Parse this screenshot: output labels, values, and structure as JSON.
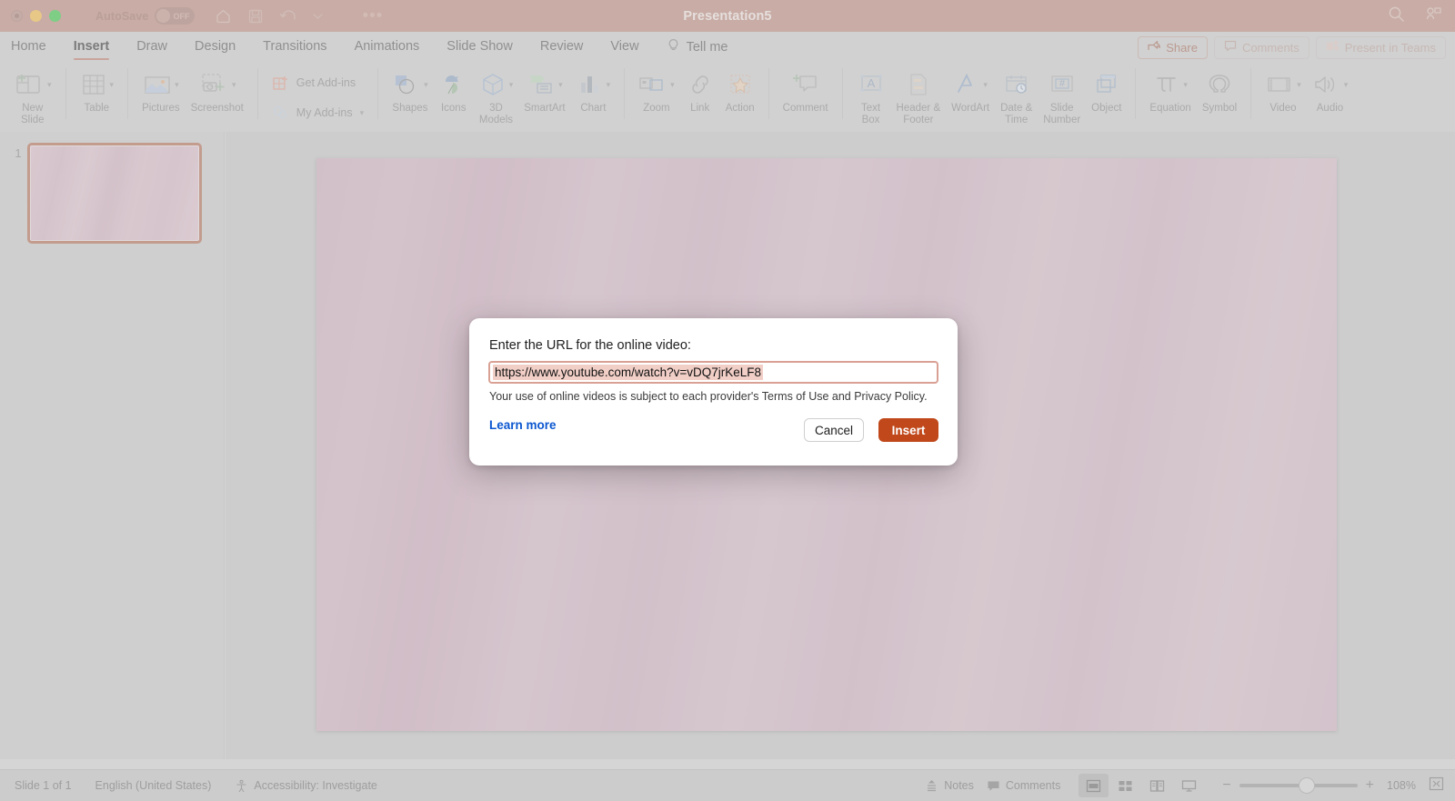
{
  "titlebar": {
    "autosave_label": "AutoSave",
    "autosave_state": "OFF",
    "document_title": "Presentation5",
    "icons": [
      "home-icon",
      "save-icon",
      "undo-icon",
      "chevron-down-icon",
      "more-icon"
    ],
    "right_icons": [
      "search-icon",
      "account-icon"
    ]
  },
  "menubar": {
    "tabs": [
      {
        "label": "Home",
        "active": false
      },
      {
        "label": "Insert",
        "active": true
      },
      {
        "label": "Draw",
        "active": false
      },
      {
        "label": "Design",
        "active": false
      },
      {
        "label": "Transitions",
        "active": false
      },
      {
        "label": "Animations",
        "active": false
      },
      {
        "label": "Slide Show",
        "active": false
      },
      {
        "label": "Review",
        "active": false
      },
      {
        "label": "View",
        "active": false
      }
    ],
    "tellme": "Tell me",
    "share": "Share",
    "comments": "Comments",
    "present_in_teams": "Present in Teams"
  },
  "ribbon": {
    "groups": [
      {
        "items": [
          {
            "label": "New\nSlide",
            "icon": "new-slide-icon",
            "chevron": true
          }
        ]
      },
      {
        "items": [
          {
            "label": "Table",
            "icon": "table-icon",
            "chevron": true
          }
        ]
      },
      {
        "items": [
          {
            "label": "Pictures",
            "icon": "pictures-icon",
            "chevron": true
          },
          {
            "label": "Screenshot",
            "icon": "screenshot-icon",
            "chevron": true
          }
        ]
      },
      {
        "stacked": [
          {
            "label": "Get Add-ins",
            "icon": "get-addins-icon",
            "chevron": false
          },
          {
            "label": "My Add-ins",
            "icon": "my-addins-icon",
            "chevron": true
          }
        ]
      },
      {
        "items": [
          {
            "label": "Shapes",
            "icon": "shapes-icon",
            "chevron": true
          },
          {
            "label": "Icons",
            "icon": "icons-icon",
            "chevron": false
          },
          {
            "label": "3D\nModels",
            "icon": "3d-models-icon",
            "chevron": true
          },
          {
            "label": "SmartArt",
            "icon": "smartart-icon",
            "chevron": true
          },
          {
            "label": "Chart",
            "icon": "chart-icon",
            "chevron": true
          }
        ]
      },
      {
        "items": [
          {
            "label": "Zoom",
            "icon": "zoom-icon",
            "chevron": true
          },
          {
            "label": "Link",
            "icon": "link-icon",
            "chevron": false
          },
          {
            "label": "Action",
            "icon": "action-icon",
            "chevron": false
          }
        ]
      },
      {
        "items": [
          {
            "label": "Comment",
            "icon": "comment-icon",
            "chevron": false
          }
        ]
      },
      {
        "items": [
          {
            "label": "Text\nBox",
            "icon": "text-box-icon",
            "chevron": false
          },
          {
            "label": "Header &\nFooter",
            "icon": "header-footer-icon",
            "chevron": false
          },
          {
            "label": "WordArt",
            "icon": "wordart-icon",
            "chevron": true
          },
          {
            "label": "Date &\nTime",
            "icon": "date-time-icon",
            "chevron": false
          },
          {
            "label": "Slide\nNumber",
            "icon": "slide-number-icon",
            "chevron": false
          },
          {
            "label": "Object",
            "icon": "object-icon",
            "chevron": false
          }
        ]
      },
      {
        "items": [
          {
            "label": "Equation",
            "icon": "equation-icon",
            "chevron": true
          },
          {
            "label": "Symbol",
            "icon": "symbol-icon",
            "chevron": false
          }
        ]
      },
      {
        "items": [
          {
            "label": "Video",
            "icon": "video-icon",
            "chevron": true
          },
          {
            "label": "Audio",
            "icon": "audio-icon",
            "chevron": true
          }
        ]
      }
    ]
  },
  "thumbnails": [
    {
      "number": "1",
      "selected": true
    }
  ],
  "dialog": {
    "label": "Enter the URL for the online video:",
    "input_value": "https://www.youtube.com/watch?v=vDQ7jrKeLF8",
    "note": "Your use of online videos is subject to each provider's Terms of Use and Privacy Policy.",
    "learn_more": "Learn more",
    "cancel": "Cancel",
    "insert": "Insert"
  },
  "statusbar": {
    "slide_count": "Slide 1 of 1",
    "language": "English (United States)",
    "accessibility": "Accessibility: Investigate",
    "notes": "Notes",
    "comments": "Comments",
    "zoom_level": "108%",
    "zoom_minus": "−",
    "zoom_plus": "+"
  },
  "colors": {
    "titlebar": "#bd8d81",
    "accent_tab": "#c08070",
    "insert_button": "#c0481a",
    "link_blue": "#0b57d0",
    "input_border": "#d9a094",
    "selection_highlight": "#f1cfc7",
    "thumb_border": "#b5735a"
  }
}
